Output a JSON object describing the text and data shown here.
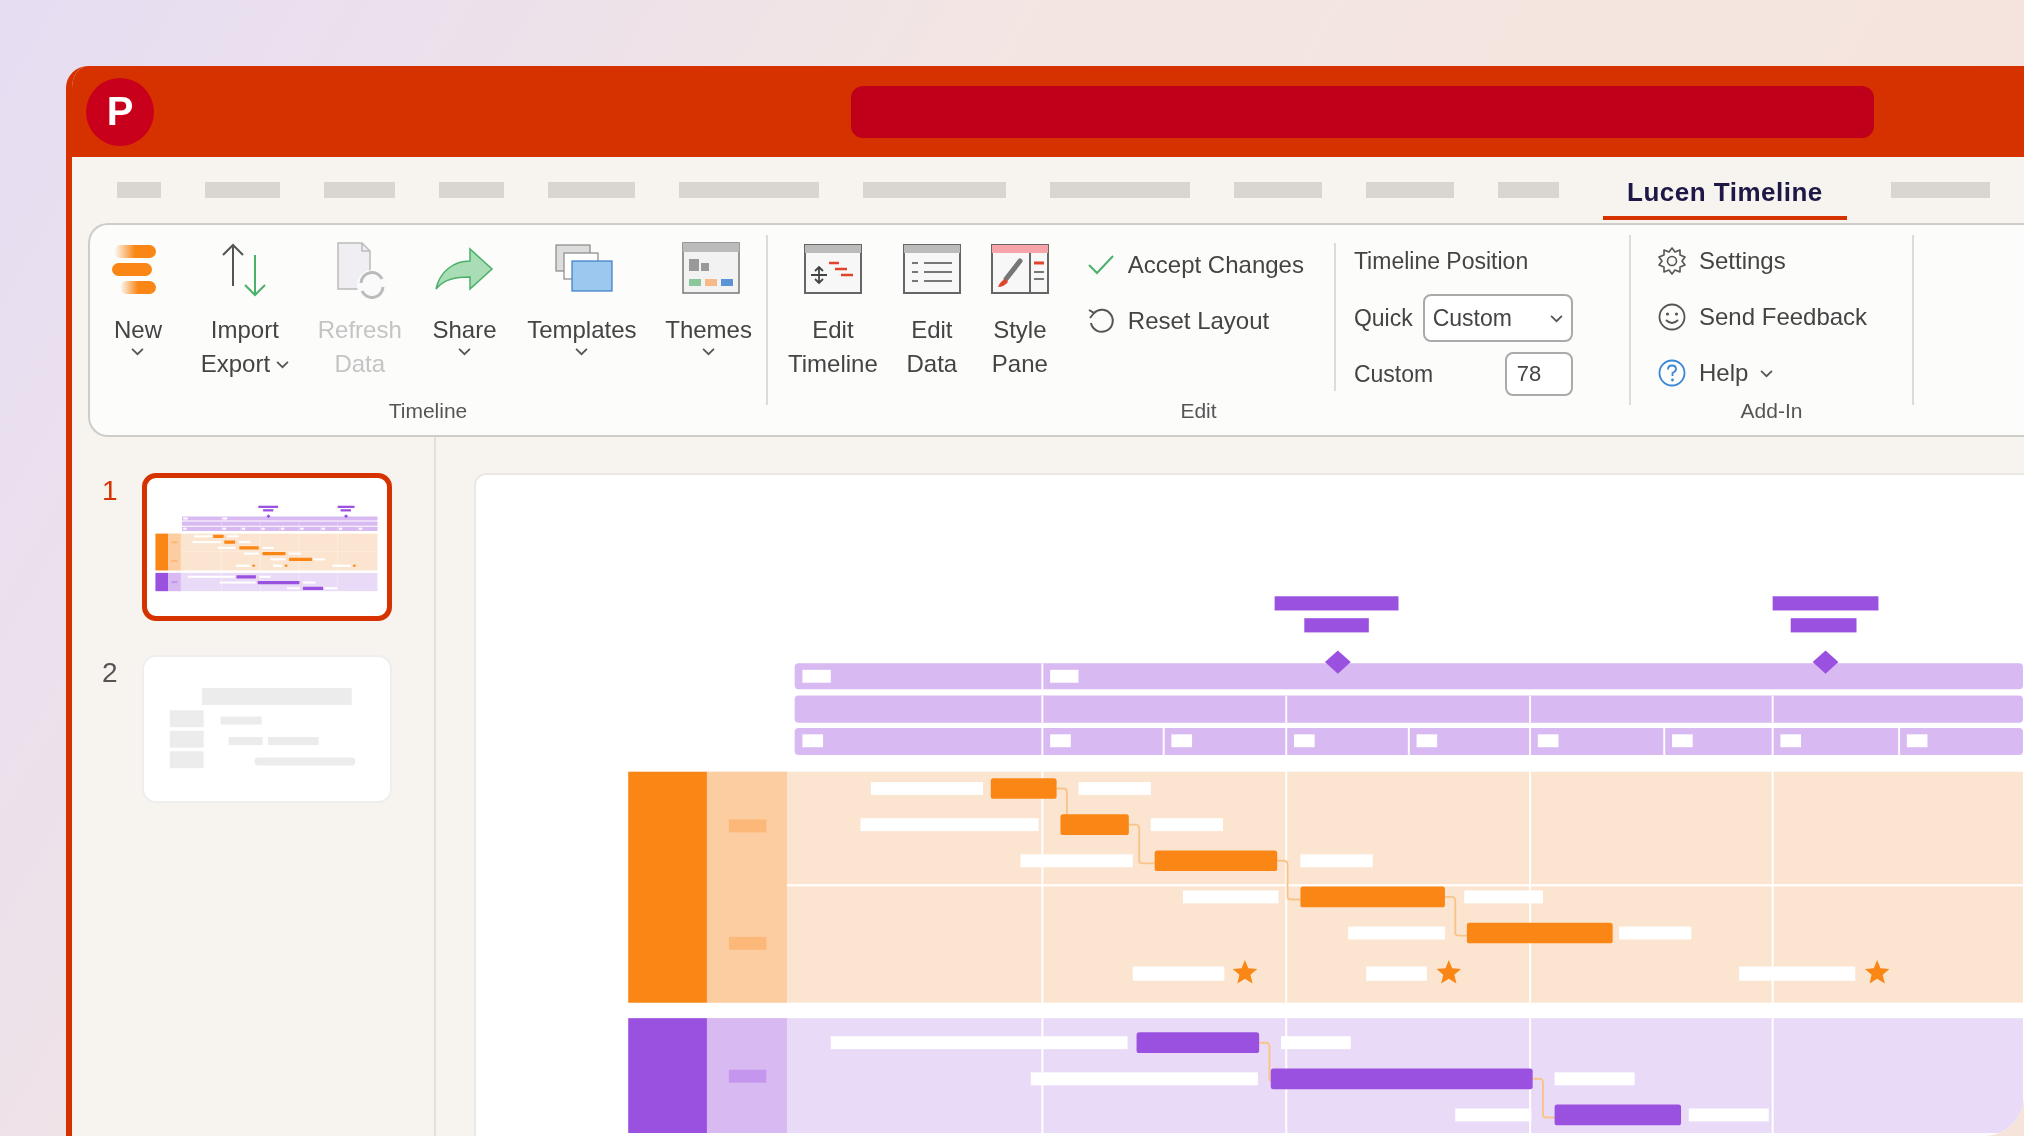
{
  "app": {
    "logo": "P"
  },
  "ribbon_tabs": [
    {
      "kind": "placeholder"
    },
    {
      "kind": "placeholder"
    },
    {
      "kind": "placeholder"
    },
    {
      "kind": "placeholder"
    },
    {
      "kind": "placeholder"
    },
    {
      "kind": "placeholder"
    },
    {
      "kind": "placeholder"
    },
    {
      "kind": "placeholder"
    },
    {
      "kind": "placeholder"
    },
    {
      "kind": "placeholder"
    },
    {
      "kind": "placeholder"
    },
    {
      "kind": "tab",
      "label": "Lucen Timeline",
      "selected": true
    },
    {
      "kind": "placeholder"
    }
  ],
  "timeline_group": {
    "label": "Timeline",
    "buttons": [
      {
        "kind": "new",
        "lines": [
          "New"
        ],
        "dropdown": true,
        "disabled": false
      },
      {
        "kind": "import-export",
        "lines": [
          "Import",
          "Export"
        ],
        "dropdown": true,
        "disabled": false
      },
      {
        "kind": "refresh",
        "lines": [
          "Refresh",
          "Data"
        ],
        "dropdown": false,
        "disabled": true
      },
      {
        "kind": "share",
        "lines": [
          "Share"
        ],
        "dropdown": true,
        "disabled": false
      },
      {
        "kind": "templates",
        "lines": [
          "Templates"
        ],
        "dropdown": true,
        "disabled": false
      },
      {
        "kind": "themes",
        "lines": [
          "Themes"
        ],
        "dropdown": true,
        "disabled": false
      }
    ]
  },
  "edit_group": {
    "label": "Edit",
    "buttons": [
      {
        "kind": "edit-timeline",
        "lines": [
          "Edit",
          "Timeline"
        ],
        "dropdown": false,
        "disabled": false
      },
      {
        "kind": "edit-data",
        "lines": [
          "Edit",
          "Data"
        ],
        "dropdown": false,
        "disabled": false
      },
      {
        "kind": "style-pane",
        "lines": [
          "Style",
          "Pane"
        ],
        "dropdown": false,
        "disabled": false
      }
    ],
    "small_buttons": [
      {
        "kind": "check",
        "label": "Accept Changes"
      },
      {
        "kind": "undo",
        "label": "Reset Layout"
      }
    ],
    "position": {
      "title": "Timeline Position",
      "quick_label": "Quick",
      "quick_value": "Custom",
      "custom_label": "Custom",
      "custom_value": "78"
    }
  },
  "addin_group": {
    "label": "Add-In",
    "items": [
      {
        "kind": "settings",
        "label": "Settings",
        "dropdown": false
      },
      {
        "kind": "feedback",
        "label": "Send Feedback",
        "dropdown": false
      },
      {
        "kind": "help",
        "label": "Help",
        "dropdown": true
      }
    ]
  },
  "slides": [
    {
      "number": "1",
      "kind": "timeline",
      "selected": true
    },
    {
      "number": "2",
      "kind": "blank",
      "selected": false
    }
  ]
}
